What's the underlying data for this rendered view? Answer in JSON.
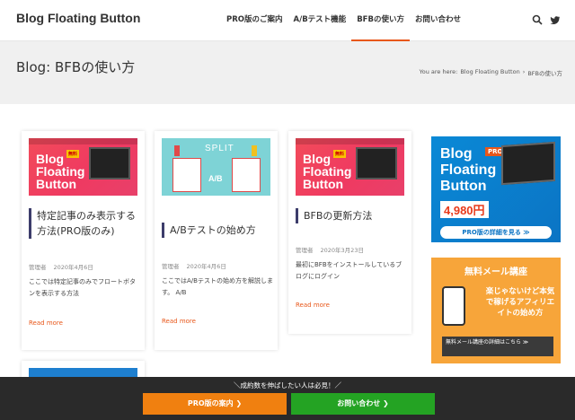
{
  "header": {
    "logo": "Blog Floating Button",
    "nav": [
      {
        "label": "PRO版のご案内",
        "active": false
      },
      {
        "label": "A/Bテスト機能",
        "active": false
      },
      {
        "label": "BFBの使い方",
        "active": true
      },
      {
        "label": "お問い合わせ",
        "active": false
      }
    ],
    "icons": [
      "search-icon",
      "twitter-icon"
    ]
  },
  "title_band": {
    "title": "Blog: BFBの使い方",
    "breadcrumb": {
      "prefix": "You are here:",
      "home": "Blog Floating Button",
      "separator": "›",
      "current": "BFBの使い方"
    }
  },
  "posts": [
    {
      "title": "特定記事のみ表示する方法(PRO版のみ)",
      "author": "管理者",
      "date": "2020年4月6日",
      "excerpt": "ここでは特定記事のみでフロートボタンを表示する方法",
      "read_more": "Read more",
      "thumb": {
        "lines": [
          "Blog",
          "Floating",
          "Button"
        ],
        "badge": "無料"
      }
    },
    {
      "title": "A/Bテストの始め方",
      "author": "管理者",
      "date": "2020年4月6日",
      "excerpt": "ここではA/Bテストの始め方を解説します。 A/B",
      "read_more": "Read more",
      "thumb": {
        "label": "SPLIT",
        "ab": "A/B"
      }
    },
    {
      "title": "BFBの更新方法",
      "author": "管理者",
      "date": "2020年3月23日",
      "excerpt": "最初にBFBをインストールしているブログにログイン",
      "read_more": "Read more",
      "thumb": {
        "lines": [
          "Blog",
          "Floating",
          "Button"
        ],
        "badge": "無料"
      }
    }
  ],
  "sidebar": {
    "ad1": {
      "lines": [
        "Blog",
        "Floating",
        "Button"
      ],
      "badge": "PRO",
      "price": "4,980円",
      "cta": "PRO版の詳細を見る ≫"
    },
    "ad2": {
      "heading": "無料メール講座",
      "body": "楽じゃないけど本気で稼げるアフィリエイトの始め方",
      "cta": "無料メール講座の詳細はこちら ≫"
    }
  },
  "floating_bar": {
    "caption": "＼成約数を伸ばしたい人は必見！／",
    "pro_button": "PRO版の案内 ❯",
    "contact_button": "お問い合わせ ❯",
    "pro_color": "#f08010",
    "contact_color": "#24a323"
  },
  "colors": {
    "accent": "#e8571a",
    "title_bar": "#3d3d6b"
  }
}
